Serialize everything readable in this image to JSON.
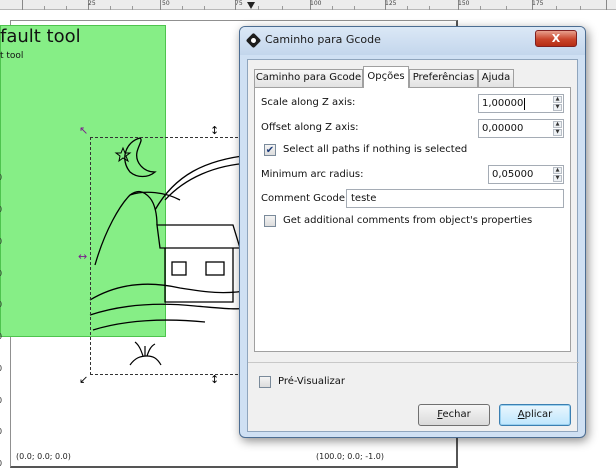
{
  "ruler": {
    "labels": [
      "25",
      "50",
      "75",
      "100",
      "125",
      "150",
      "175"
    ]
  },
  "canvas": {
    "tool_label_large": "fault tool",
    "tool_label_small": "t tool",
    "zeros": [
      "0",
      "0",
      "0",
      "0",
      "0",
      "0",
      "0",
      "0",
      "0",
      "0"
    ],
    "coord_bottom_left": "(0.0; 0.0; 0.0)",
    "coord_bottom_right": "(100.0; 0.0; -1.0)"
  },
  "dialog": {
    "title": "Caminho para Gcode",
    "close_label": "X",
    "tabs": [
      {
        "label": "Caminho para Gcode",
        "active": false
      },
      {
        "label": "Opções",
        "active": true
      },
      {
        "label": "Preferências",
        "active": false
      },
      {
        "label": "Ajuda",
        "active": false
      }
    ],
    "options": {
      "scale_z_label": "Scale along Z axis:",
      "scale_z_value": "1,00000",
      "offset_z_label": "Offset along Z axis:",
      "offset_z_value": "0,00000",
      "select_all_label": "Select all paths if nothing is selected",
      "select_all_checked": true,
      "min_arc_label": "Minimum arc radius:",
      "min_arc_value": "0,05000",
      "comment_label": "Comment Gcode:",
      "comment_value": "teste",
      "additional_comments_label": "Get additional comments from object's properties",
      "additional_comments_checked": false
    },
    "preview_label": "Pré-Visualizar",
    "preview_checked": false,
    "close_button": {
      "first_letter": "F",
      "rest": "echar"
    },
    "apply_button": {
      "first_letter": "A",
      "rest": "plicar"
    }
  }
}
